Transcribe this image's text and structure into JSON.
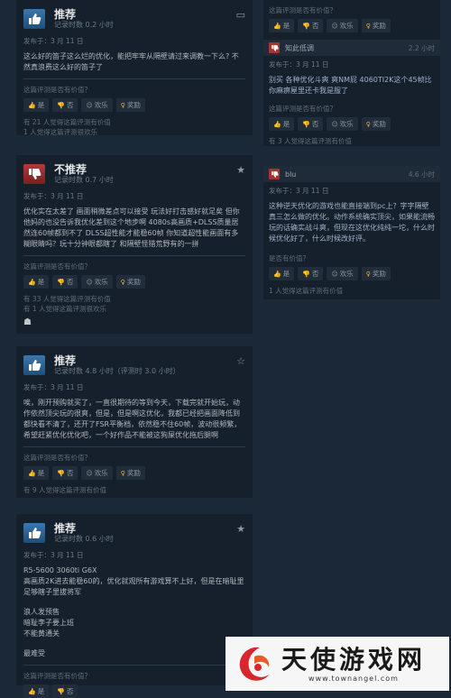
{
  "labels": {
    "helpful_question": "这篇评测是否有价值？",
    "yes": "是",
    "no": "否",
    "funny": "欢乐",
    "award": "奖励"
  },
  "reviews": [
    {
      "verdict": "推荐",
      "hours": "记录时数 0.2 小时",
      "posted": "发布于：3 月 11 日",
      "text": "这么好的笛子这么烂的优化，能把牢牢从隔壁请过来调教一下么? 不然真浪费这么好的笛子了",
      "stats": [
        "有 21 人觉得这篇评测有价值",
        "1 人觉得这篇评测很欢乐"
      ]
    },
    {
      "verdict": "不推荐",
      "hours": "记录时数 0.7 小时",
      "posted": "发布于：3 月 11 日",
      "text": "优化实在太差了 画面稍微差点可以接受 玩法好打击感好就足矣 但你他妈的也没告诉我优化差到这个地步啊 4080s高画质+DLSS质量居然连60帧都到不了 DLSS超性能才能稳60帧 你知道超性能画面有多糊眼睛吗？玩十分钟眼都瞎了 和隔壁怪猎荒野有的一拼",
      "stats": [
        "有 33 人觉得这篇评测有价值",
        "有 1 人觉得这篇评测很欢乐"
      ]
    },
    {
      "verdict": "推荐",
      "hours": "记录时数 4.8 小时（评测时 3.0 小时）",
      "posted": "发布于：3 月 11 日",
      "text": "唉，刚开预购就买了，一直很期待的等到今天，下载完就开始玩，动作依然顶尖玩的很爽，但是，但是啊这优化，我都已经把画面降低到都快看不清了，还开了FSR平衡档，依然稳不住60帧，波动很频繁，希望赶紧优化优化吧，一个好作品不能被这狗屎优化拖后腿啊",
      "stats": [
        "有 9 人觉得这篇评测有价值"
      ]
    },
    {
      "verdict": "推荐",
      "hours": "记录时数 0.6 小时",
      "posted": "发布于：3 月 11 日",
      "text_lines": [
        "R5-5600 3060ti G6X",
        "高画质2K进去能稳60的，优化就观所有游戏算不上好，但是在暗耻里足够瞎子里拔将军",
        "",
        "浪人发预售",
        "暗耻李子要上班",
        "不能黄通关",
        "",
        "最难受"
      ]
    }
  ],
  "right": {
    "top_stats": [
      "有 3 人觉得这篇评测有价值"
    ],
    "cards": [
      {
        "user": "知此低调",
        "hours": "2.2 小时",
        "posted": "发布于：3 月 11 日",
        "text": "别买 各种优化斗爽 爽NM屁 4060TI2K这个45帧比你麻痹屋里还卡我是服了",
        "stats": [
          "有 3 人觉得这篇评测有价值"
        ]
      },
      {
        "user": "blu",
        "hours": "4.6 小时",
        "posted": "发布于：3 月 11 日",
        "text": "这种逆天优化的游戏也能直接端到pc上？字字隔壁真三怎么做的优化。动作系统确实顶尖，如果能流畅玩的话确实战斗爽，但现在这优化纯纯一坨，什么时候优化好了，什么时候改好评。",
        "question": "是否有价值？",
        "stats": [
          "1 人觉得这篇评测有价值"
        ]
      }
    ]
  },
  "watermark": {
    "brand": "天使游戏网",
    "url": "www.townangel.com"
  }
}
